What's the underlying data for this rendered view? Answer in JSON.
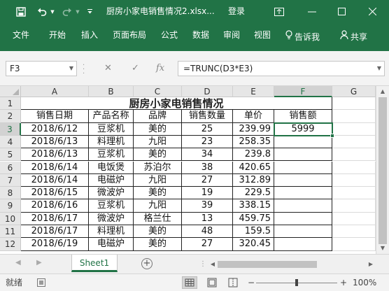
{
  "app": {
    "title": "厨房小家电销售情况2.xlsx...",
    "login_label": "登录",
    "accent": "#217346"
  },
  "ribbon": {
    "tabs": [
      "文件",
      "开始",
      "插入",
      "页面布局",
      "公式",
      "数据",
      "审阅",
      "视图"
    ],
    "tell_me": "告诉我",
    "share": "共享"
  },
  "formula_bar": {
    "name_box": "F3",
    "formula": "=TRUNC(D3*E3)",
    "fx_label": "fx"
  },
  "sheet": {
    "columns": [
      "A",
      "B",
      "C",
      "D",
      "E",
      "F",
      "G"
    ],
    "selected_column": "F",
    "rows": [
      "1",
      "2",
      "3",
      "4",
      "5",
      "6",
      "7",
      "8",
      "9",
      "10",
      "11",
      "12"
    ],
    "selected_row": "3",
    "title": "厨房小家电销售情况",
    "headers": [
      "销售日期",
      "产品名称",
      "品牌",
      "销售数量",
      "单价",
      "销售额"
    ],
    "data": [
      [
        "2018/6/12",
        "豆浆机",
        "美的",
        "25",
        "239.99",
        "5999"
      ],
      [
        "2018/6/13",
        "料理机",
        "九阳",
        "23",
        "258.35",
        ""
      ],
      [
        "2018/6/13",
        "豆浆机",
        "美的",
        "34",
        "239.8",
        ""
      ],
      [
        "2018/6/14",
        "电饭煲",
        "苏泊尔",
        "38",
        "420.65",
        ""
      ],
      [
        "2018/6/14",
        "电磁炉",
        "九阳",
        "27",
        "312.89",
        ""
      ],
      [
        "2018/6/15",
        "微波炉",
        "美的",
        "19",
        "229.5",
        ""
      ],
      [
        "2018/6/16",
        "豆浆机",
        "九阳",
        "39",
        "338.15",
        ""
      ],
      [
        "2018/6/17",
        "微波炉",
        "格兰仕",
        "13",
        "459.75",
        ""
      ],
      [
        "2018/6/17",
        "料理机",
        "美的",
        "48",
        "159.5",
        ""
      ],
      [
        "2018/6/19",
        "电磁炉",
        "美的",
        "27",
        "320.45",
        ""
      ]
    ]
  },
  "sheet_tabs": {
    "active": "Sheet1"
  },
  "status_bar": {
    "ready": "就绪",
    "zoom_level": "100%"
  }
}
